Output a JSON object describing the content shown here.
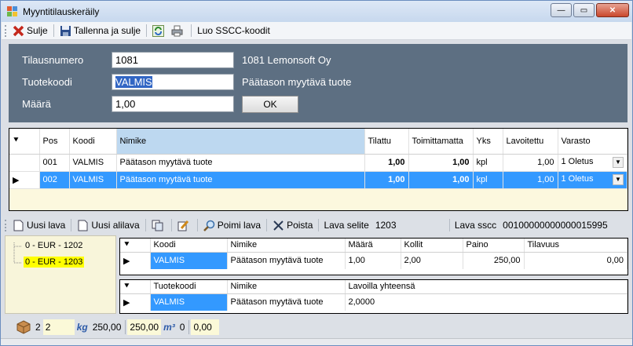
{
  "window": {
    "title": "Myyntitilauskeräily"
  },
  "toolbar": {
    "close_label": "Sulje",
    "save_close_label": "Tallenna ja sulje",
    "sscc_label": "Luo SSCC-koodit"
  },
  "form": {
    "order_label": "Tilausnumero",
    "order_value": "1081",
    "order_customer": "1081 Lemonsoft Oy",
    "product_label": "Tuotekoodi",
    "product_value": "VALMIS",
    "product_name": "Päätason myytävä tuote",
    "qty_label": "Määrä",
    "qty_value": "1,00",
    "ok_label": "OK"
  },
  "rows_grid": {
    "headers": {
      "pos": "Pos",
      "code": "Koodi",
      "name": "Nimike",
      "ordered": "Tilattu",
      "undelivered": "Toimittamatta",
      "unit": "Yks",
      "palletized": "Lavoitettu",
      "warehouse": "Varasto"
    },
    "rows": [
      {
        "pos": "001",
        "code": "VALMIS",
        "name": "Päätason myytävä tuote",
        "ordered": "1,00",
        "undelivered": "1,00",
        "unit": "kpl",
        "palletized": "1,00",
        "warehouse": "1 Oletus"
      },
      {
        "pos": "002",
        "code": "VALMIS",
        "name": "Päätason myytävä tuote",
        "ordered": "1,00",
        "undelivered": "1,00",
        "unit": "kpl",
        "palletized": "1,00",
        "warehouse": "1 Oletus"
      }
    ]
  },
  "pallet_toolbar": {
    "new_pallet": "Uusi lava",
    "new_subpallet": "Uusi alilava",
    "pick_pallet": "Poimi lava",
    "delete": "Poista",
    "pallet_desc_label": "Lava selite",
    "pallet_desc_value": "1203",
    "pallet_sscc_label": "Lava sscc",
    "pallet_sscc_value": "00100000000000015995"
  },
  "tree": {
    "items": [
      "0 - EUR - 1202",
      "0 - EUR - 1203"
    ]
  },
  "pallet_grid": {
    "headers": {
      "code": "Koodi",
      "name": "Nimike",
      "qty": "Määrä",
      "packages": "Kollit",
      "weight": "Paino",
      "volume": "Tilavuus"
    },
    "row": {
      "code": "VALMIS",
      "name": "Päätason myytävä tuote",
      "qty": "1,00",
      "packages": "2,00",
      "weight": "250,00",
      "volume": "0,00"
    }
  },
  "summary_grid": {
    "headers": {
      "code": "Tuotekoodi",
      "name": "Nimike",
      "total": "Lavoilla yhteensä"
    },
    "row": {
      "code": "VALMIS",
      "name": "Päätason myytävä tuote",
      "total": "2,0000"
    }
  },
  "status": {
    "packages_a": "2",
    "packages_b": "2",
    "kg_label": "kg",
    "weight_a": "250,00",
    "weight_b": "250,00",
    "m3_label": "m³",
    "volume_a": "0",
    "volume_b": "0,00"
  }
}
